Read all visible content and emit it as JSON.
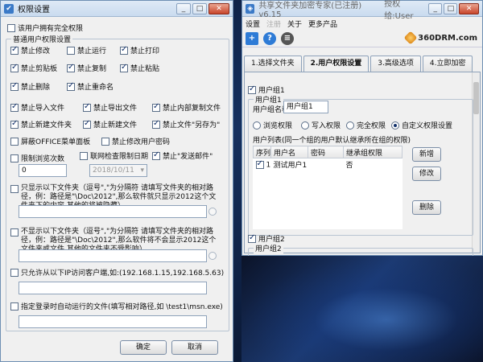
{
  "left_window": {
    "title": "权限设置",
    "full_permission": "该用户拥有完全权限",
    "normal_group_label": "普通用户权限设置",
    "perms_row1": [
      "禁止修改",
      "禁止运行",
      "禁止打印"
    ],
    "perms_row2": [
      "禁止剪贴板",
      "禁止复制",
      "禁止粘贴"
    ],
    "perms_row3": [
      "禁止删除",
      "禁止重命名"
    ],
    "perms_row4": [
      "禁止导入文件",
      "禁止导出文件",
      "禁止内部复制文件"
    ],
    "perms_row5": [
      "禁止新建文件夹",
      "禁止新建文件",
      "禁止文件\"另存为\""
    ],
    "perms_row6": [
      "屏蔽OFFICE菜单面板",
      "禁止修改用户密码"
    ],
    "perms_row7": [
      "限制浏览次数",
      "联网检查限制日期",
      "禁止\"发送邮件\""
    ],
    "views_value": "0",
    "date_value": "2018/10/11",
    "only_show_desc": "只显示以下文件夹（逗号\",\"为分隔符 请填写文件夹的相对路径，例：路径是\"\\Doc\\2012\",那么软件就只显示2012这个文件夹下的内容,其他的将被隐藏）",
    "hide_desc": "不显示以下文件夹（逗号\",\"为分隔符 请填写文件夹的相对路径，例：路径是\"\\Doc\\2012\",那么软件将不会显示2012这个文件夹或文件,其他的文件夹不受影响）",
    "ip_desc": "只允许从以下IP访问客户端,如:(192.168.1.15,192.168.5.63)",
    "autorun_desc": "指定登录时自动运行的文件(填写相对路径,如 \\test1\\msn.exe)",
    "ok_label": "确定",
    "cancel_label": "取消"
  },
  "right_window": {
    "title_main": "共享文件夹加密专家(已注册) v6.15",
    "title_extra": "授权给:User",
    "menu": [
      "设置",
      "注册",
      "关于",
      "更多产品"
    ],
    "logo": "360DRM.com",
    "tabs": [
      "1.选择文件夹",
      "2.用户权限设置",
      "3.高级选项",
      "4.立即加密"
    ],
    "group1_label": "用户组1",
    "group1_inner": "用户组1",
    "group_name_label": "用户组名称",
    "group_name_value": "用户组1",
    "radios": [
      "浏览权限",
      "写入权限",
      "完全权限",
      "自定义权限设置"
    ],
    "user_list_label": "用户列表(同一个组的用户默认继承所在组的权限)",
    "columns": [
      "序列",
      "用户名",
      "密码",
      "继承组权限"
    ],
    "rows": [
      {
        "index": "1",
        "name": "测试用户1",
        "password": "",
        "inherit": "否"
      }
    ],
    "btn_add": "新增",
    "btn_edit": "修改",
    "btn_delete": "删除",
    "group2_label": "用户组2",
    "group2_inner": "用户组2"
  }
}
